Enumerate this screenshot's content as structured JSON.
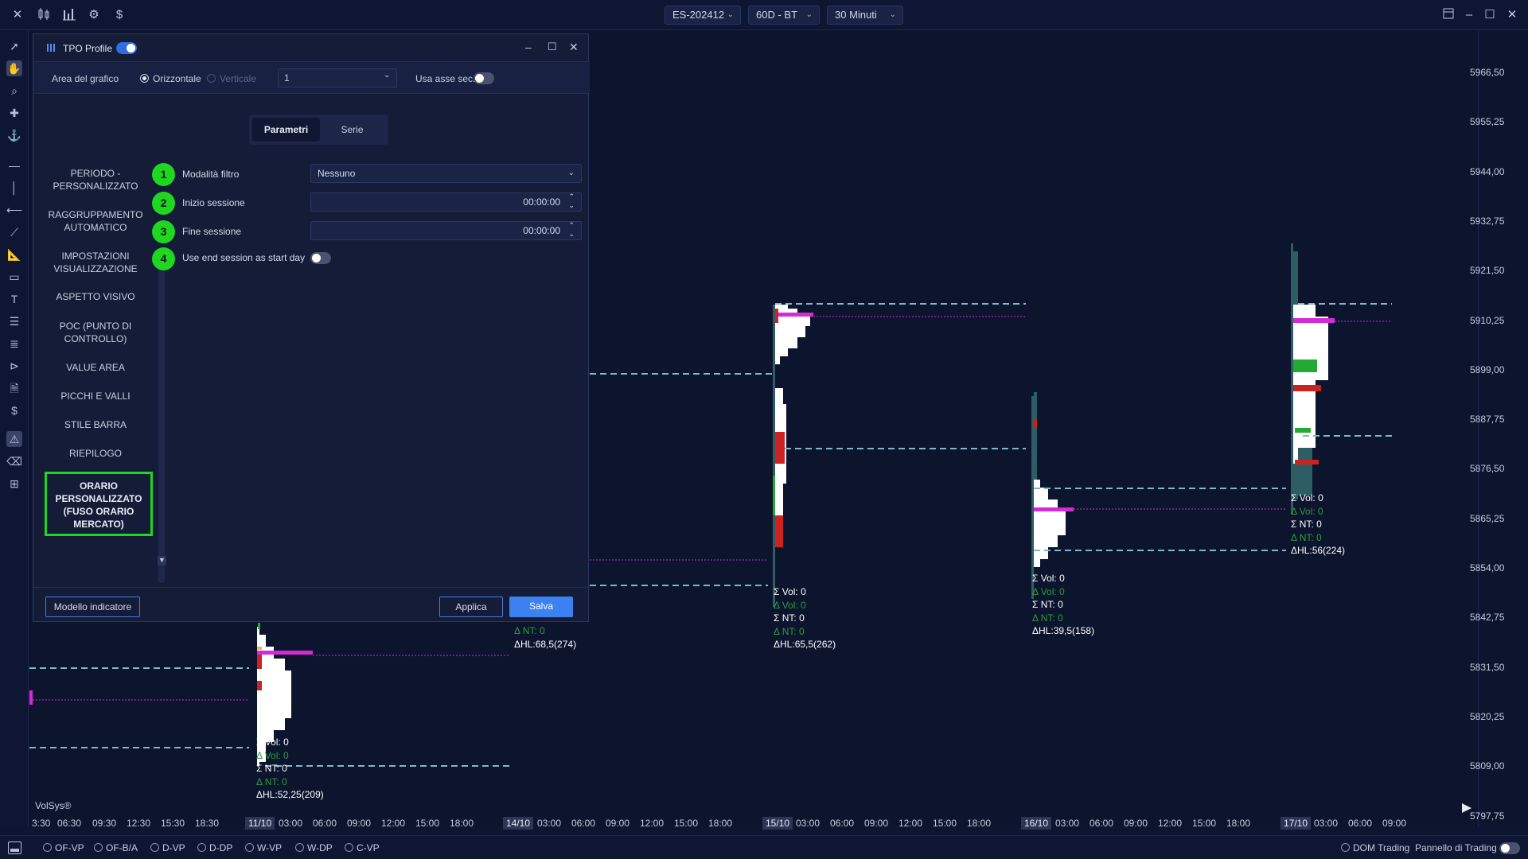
{
  "topbar": {
    "symbol": "ES-202412",
    "range": "60D - BT",
    "interval": "30 Minuti",
    "icons": [
      "close-icon",
      "candlestick-icon",
      "bar-chart-icon",
      "settings-icon",
      "dollar-icon"
    ],
    "window_icons": [
      "layout-icon",
      "minimize-icon",
      "maximize-icon",
      "close-icon"
    ]
  },
  "dialog": {
    "title": "TPO Profile",
    "enabled": true,
    "area_label": "Area del grafico",
    "orient_h": "Orizzontale",
    "orient_v": "Verticale",
    "area_value": "1",
    "secondary_axis_label": "Usa asse sec.",
    "tabs": [
      "Parametri",
      "Serie"
    ],
    "nav": [
      "PERIODO - PERSONALIZZATO",
      "RAGGRUPPAMENTO AUTOMATICO",
      "IMPOSTAZIONI VISUALIZZAZIONE",
      "ASPETTO VISIVO",
      "POC (PUNTO DI CONTROLLO)",
      "VALUE AREA",
      "PICCHI E VALLI",
      "STILE BARRA",
      "RIEPILOGO",
      "ORARIO PERSONALIZZATO (FUSO ORARIO MERCATO)"
    ],
    "fields": [
      {
        "num": "1",
        "label": "Modalità filtro",
        "value": "Nessuno"
      },
      {
        "num": "2",
        "label": "Inizio sessione",
        "value": "00:00:00"
      },
      {
        "num": "3",
        "label": "Fine sessione",
        "value": "00:00:00"
      },
      {
        "num": "4",
        "label": "Use end session as start day",
        "value": ""
      }
    ],
    "btn_template": "Modello indicatore",
    "btn_apply": "Applica",
    "btn_save": "Salva"
  },
  "chart": {
    "watermark": "VolSys®",
    "prices": [
      "5966,50",
      "5955,25",
      "5944,00",
      "5932,75",
      "5921,50",
      "5910,25",
      "5899,00",
      "5887,75",
      "5876,50",
      "5865,25",
      "5854,00",
      "5842,75",
      "5831,50",
      "5820,25",
      "5809,00",
      "5797,75"
    ],
    "times": [
      "3:30",
      "06:30",
      "09:30",
      "12:30",
      "15:30",
      "18:30",
      "11/10",
      "03:00",
      "06:00",
      "09:00",
      "12:00",
      "15:00",
      "18:00",
      "14/10",
      "03:00",
      "06:00",
      "09:00",
      "12:00",
      "15:00",
      "18:00",
      "15/10",
      "03:00",
      "06:00",
      "09:00",
      "12:00",
      "15:00",
      "18:00",
      "16/10",
      "03:00",
      "06:00",
      "09:00",
      "12:00",
      "15:00",
      "18:00",
      "17/10",
      "03:00",
      "06:00",
      "09:00"
    ],
    "stats": [
      {
        "vol": "Σ Vol: 0",
        "dvol": "Δ Vol: 0",
        "nt": "Σ NT: 0",
        "dnt": "Δ NT: 0",
        "hl": "ΔHL:52,25(209)"
      },
      {
        "vol": "",
        "dvol": "",
        "nt": "",
        "dnt": "Δ NT: 0",
        "hl": "ΔHL:68,5(274)"
      },
      {
        "vol": "Σ Vol: 0",
        "dvol": "Δ Vol: 0",
        "nt": "Σ NT: 0",
        "dnt": "Δ NT: 0",
        "hl": "ΔHL:65,5(262)"
      },
      {
        "vol": "Σ Vol: 0",
        "dvol": "Δ Vol: 0",
        "nt": "Σ NT: 0",
        "dnt": "Δ NT: 0",
        "hl": "ΔHL:39,5(158)"
      },
      {
        "vol": "Σ Vol: 0",
        "dvol": "Δ Vol: 0",
        "nt": "Σ NT: 0",
        "dnt": "Δ NT: 0",
        "hl": "ΔHL:56(224)"
      }
    ]
  },
  "bottombar": {
    "modes": [
      "OF-VP",
      "OF-B/A",
      "D-VP",
      "D-DP",
      "W-VP",
      "W-DP",
      "C-VP"
    ],
    "dom": "DOM Trading",
    "panel": "Pannello di Trading"
  },
  "colors": {
    "bg": "#0c142e",
    "accent": "#2f6de0",
    "green": "#1fd620",
    "poc": "#d62ad6",
    "value_area": "#7fb8c8"
  }
}
